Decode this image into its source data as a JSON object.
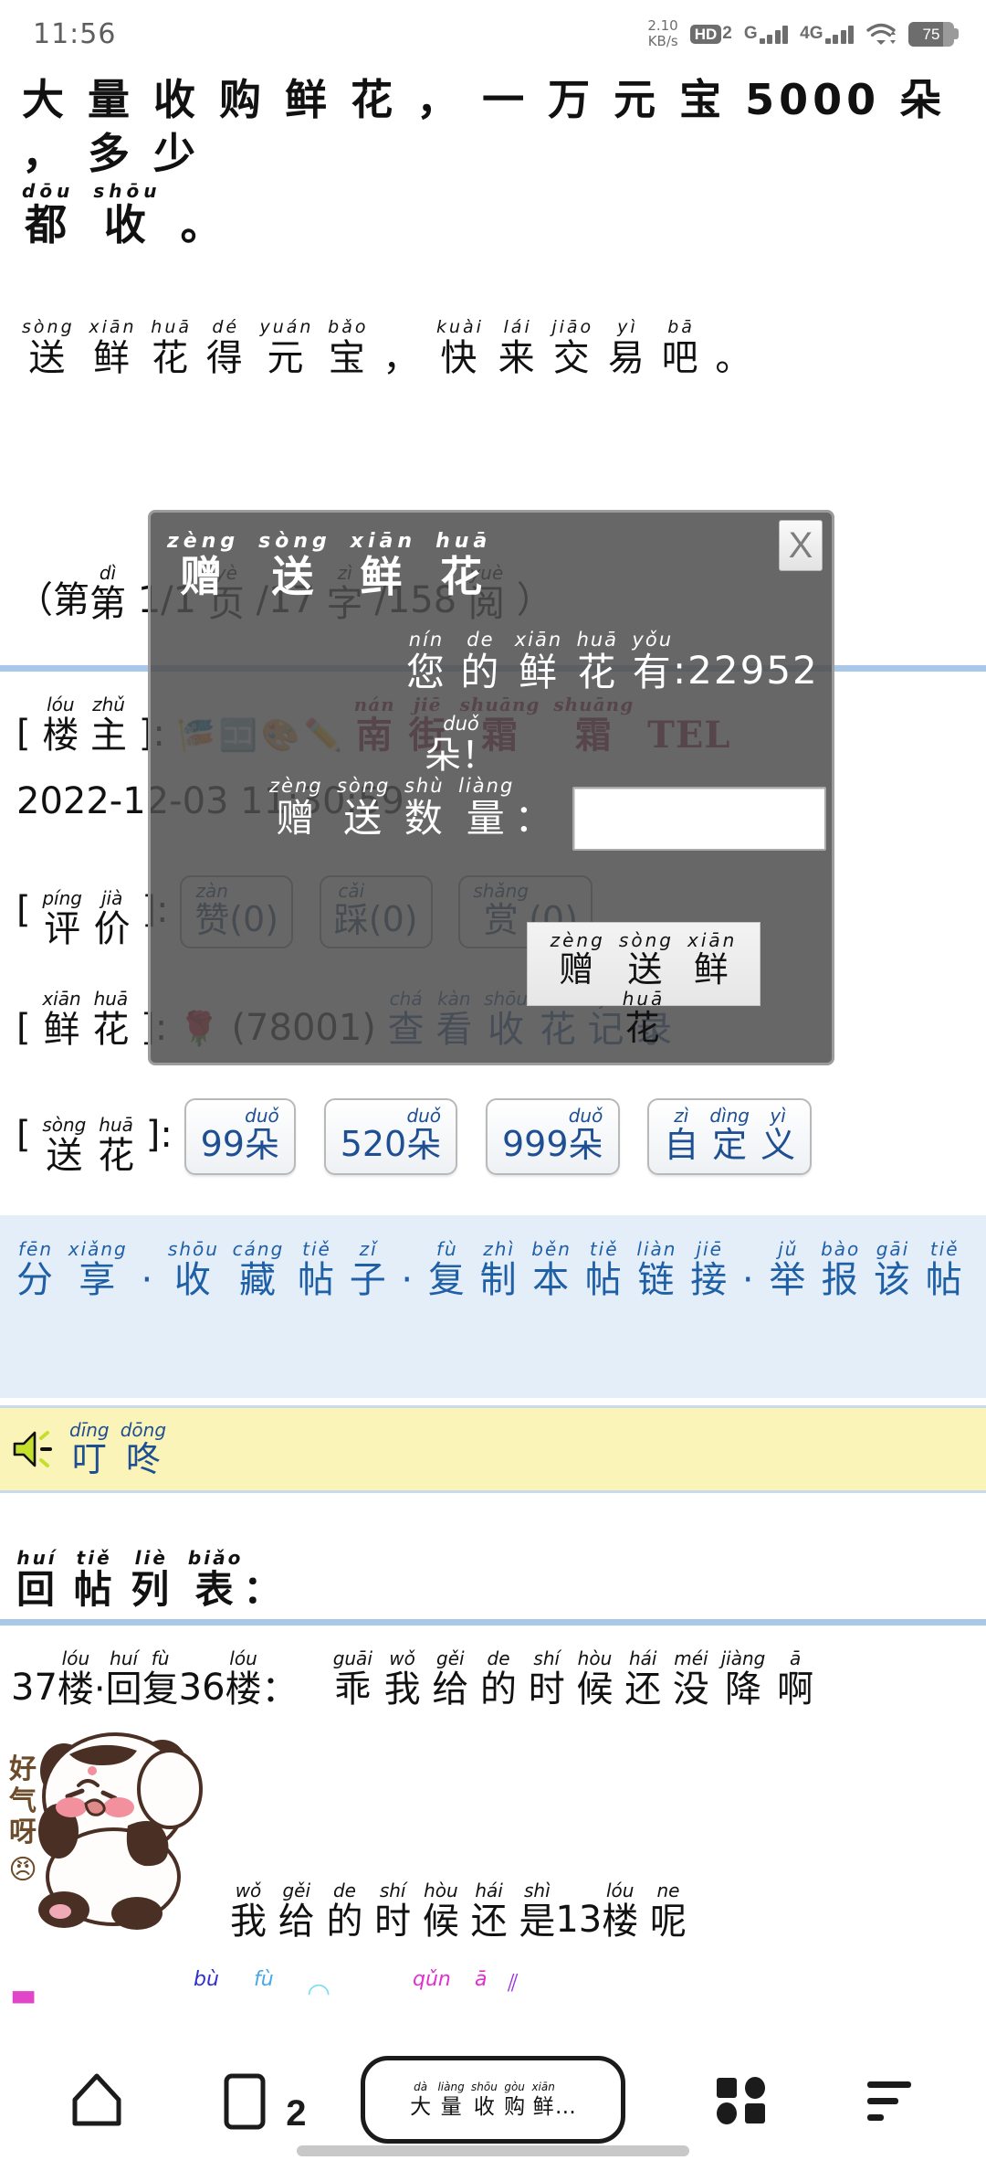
{
  "statusbar": {
    "time": "11:56",
    "netspeed_value": "2.10",
    "netspeed_unit": "KB/s",
    "hd_label": "HD",
    "hd_sub": "2",
    "sim1_net": "G",
    "sim2_net": "4G",
    "battery_percent": "75",
    "wifi_icon": "wifi-icon",
    "battery_icon": "battery-icon"
  },
  "post": {
    "title_chars": [
      "大",
      "量",
      "收",
      "购",
      "鲜",
      "花",
      "，",
      "一",
      "万",
      "元",
      "宝",
      "5000",
      "朵",
      "，",
      "多",
      "少"
    ],
    "title_pinyin": [
      "",
      "",
      "",
      "",
      "",
      "",
      "",
      "",
      "",
      "",
      "",
      "",
      "",
      "",
      "",
      ""
    ],
    "title_line2_chars": [
      "都",
      "收",
      "。"
    ],
    "title_line2_pinyin": [
      "dōu",
      "shōu",
      ""
    ],
    "body_chars": [
      "送",
      "鲜",
      "花",
      "得",
      "元",
      "宝",
      "，",
      "快",
      "来",
      "交",
      "易",
      "吧",
      "。"
    ],
    "body_pinyin": [
      "sòng",
      "xiān",
      "huā",
      "dé",
      "yuán",
      "bǎo",
      "",
      "kuài",
      "lái",
      "jiāo",
      "yì",
      "bā",
      ""
    ]
  },
  "meta": {
    "page_prefix": "（第",
    "page_di": "dì",
    "page_value": "1/1",
    "page_ye_py": "yè",
    "page_ye": "页",
    "page_sep1": "/17",
    "page_zi_py": "zì",
    "page_zi": "字",
    "page_sep2": "/158",
    "page_yue_py": "yuè",
    "page_yue": "阅",
    "page_suffix": "）",
    "lz_open": "[",
    "lz_py1": "lóu",
    "lz_ch1": "楼",
    "lz_py2": "zhǔ",
    "lz_ch2": "主",
    "lz_close": "]:",
    "username": "南街霜霜TEL",
    "username_py": [
      "nán",
      "jiē",
      "shuāng",
      "shuāng",
      ""
    ],
    "username_ch": [
      "南",
      "街",
      "霜",
      "霜",
      "TEL"
    ],
    "timestamp": "2022-12-03 11:30:59",
    "eval_open": "[",
    "eval_py1": "píng",
    "eval_ch1": "评",
    "eval_py2": "jià",
    "eval_ch2": "价",
    "eval_close": "]:",
    "eval_buttons": [
      {
        "py": "zàn",
        "ch": "赞",
        "count": "(0)"
      },
      {
        "py": "cǎi",
        "ch": "踩",
        "count": "(0)"
      },
      {
        "py": "shǎng",
        "ch": "赏",
        "count": "(0)"
      }
    ],
    "flower_open": "[",
    "flower_py1": "xiān",
    "flower_ch1": "鲜",
    "flower_py2": "huā",
    "flower_ch2": "花",
    "flower_close": "]:",
    "flower_icon": "rose-icon",
    "flower_count": "(78001)",
    "flower_link_py": [
      "chá",
      "kàn",
      "shōu",
      "huā",
      "jì",
      "lù"
    ],
    "flower_link_ch": [
      "查",
      "看",
      "收",
      "花",
      "记",
      "录"
    ],
    "send_open": "[",
    "send_py1": "sòng",
    "send_ch1": "送",
    "send_py2": "huā",
    "send_ch2": "花",
    "send_close": "]:",
    "send_buttons": [
      {
        "num": "99",
        "py": "duǒ",
        "ch": "朵"
      },
      {
        "num": "520",
        "py": "duǒ",
        "ch": "朵"
      },
      {
        "num": "999",
        "py": "duǒ",
        "ch": "朵"
      },
      {
        "num": "",
        "py": "",
        "ch": ""
      }
    ],
    "custom_py": [
      "zì",
      "dìng",
      "yì"
    ],
    "custom_ch": [
      "自",
      "定",
      "义"
    ]
  },
  "sharebar": {
    "pinyin": [
      "fēn",
      "xiǎng",
      "",
      "shōu",
      "cáng",
      "tiě",
      "zǐ",
      "",
      "fù",
      "zhì",
      "běn",
      "tiě",
      "liàn",
      "jiē",
      "",
      "jǔ",
      "bào",
      "gāi",
      "tiě"
    ],
    "chars": [
      "分",
      "享",
      "·",
      "收",
      "藏",
      "帖",
      "子",
      "·",
      "复",
      "制",
      "本",
      "帖",
      "链",
      "接",
      "·",
      "举",
      "报",
      "该",
      "帖"
    ]
  },
  "notify": {
    "icon": "speaker-icon",
    "pinyin": [
      "dīng",
      "dōng"
    ],
    "chars": [
      "叮",
      "咚"
    ]
  },
  "replies": {
    "heading_py": [
      "huí",
      "tiě",
      "liè",
      "biǎo"
    ],
    "heading_ch": [
      "回",
      "帖",
      "列",
      "表",
      "："
    ],
    "item1_prefix": "37",
    "item1_py": [
      "lóu",
      "huí",
      "fù",
      "",
      "lóu"
    ],
    "item1_ch": [
      "楼",
      "·",
      "回",
      "复",
      "36",
      "楼",
      "："
    ],
    "item1_msg_py": [
      "guāi",
      "wǒ",
      "gěi",
      "de",
      "shí",
      "hòu",
      "hái",
      "méi",
      "jiàng",
      "ā"
    ],
    "item1_msg_ch": [
      "乖",
      "我",
      "给",
      "的",
      "时",
      "候",
      "还",
      "没",
      "降",
      "啊"
    ],
    "sticker_name": "panda-angry-sticker",
    "sticker_label": "好气呀",
    "sticker_emoji": "😠",
    "item2_py": [
      "wǒ",
      "gěi",
      "de",
      "shí",
      "hòu",
      "hái",
      "shì",
      "",
      "lóu",
      "ne"
    ],
    "item2_ch": [
      "我",
      "给",
      "的",
      "时",
      "候",
      "还",
      "是",
      "13",
      "楼",
      "呢"
    ],
    "cut_py": [
      "bù",
      "fù",
      "",
      "qǔn",
      "ā"
    ],
    "cut_ch": [
      "",
      "",
      "",
      "",
      ""
    ]
  },
  "modal": {
    "title_py": [
      "zèng",
      "sòng",
      "xiān",
      "huā"
    ],
    "title_ch": [
      "赠",
      "送",
      "鲜",
      "花"
    ],
    "close_label": "X",
    "flowers_py": [
      "nín",
      "de",
      "xiān",
      "huā",
      "yǒu"
    ],
    "flowers_ch": [
      "您",
      "的",
      "鲜",
      "花",
      "有"
    ],
    "flowers_colon": ":",
    "flowers_count": "22952",
    "duo_py": "duǒ",
    "duo_ch": "朵！",
    "qty_py": [
      "zèng",
      "sòng",
      "shù",
      "liàng"
    ],
    "qty_ch": [
      "赠",
      "送",
      "数",
      "量",
      "："
    ],
    "qty_value": "",
    "qty_placeholder": "",
    "submit_py": [
      "zèng",
      "sòng",
      "xiān",
      "huā"
    ],
    "submit_ch": [
      "赠",
      "送",
      "鲜",
      "花"
    ]
  },
  "navbar": {
    "home_icon": "home-icon",
    "tabs_icon": "tabs-icon",
    "tabs_count": "2",
    "address_py": [
      "dà",
      "liàng",
      "shōu",
      "gòu",
      "xiān"
    ],
    "address_ch": [
      "大",
      "量",
      "收",
      "购",
      "鲜",
      "…"
    ],
    "apps_icon": "apps-grid-icon",
    "menu_icon": "menu-icon"
  },
  "colors": {
    "accent_blue": "#1f5fa6",
    "share_bg": "#e4eef9",
    "notify_bg": "#fbf4b8",
    "divider": "#a9c7e8",
    "modal_bg": "#4e4e4e",
    "username": "#8f1240"
  }
}
